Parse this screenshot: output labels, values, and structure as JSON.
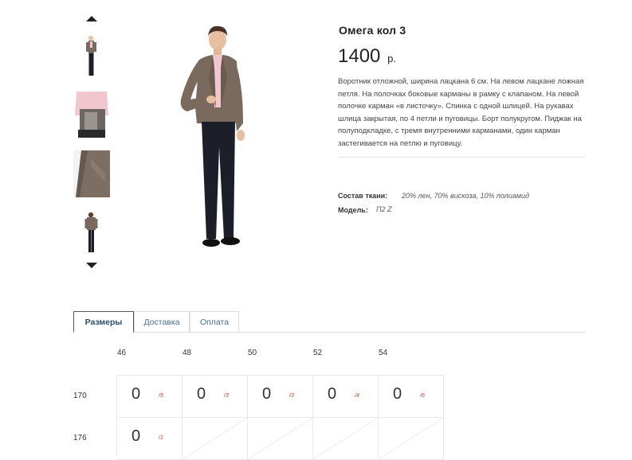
{
  "product": {
    "title": "Омега кол 3",
    "price": "1400",
    "currency": "р.",
    "description": "Воротник отложной, ширина лацкана 6 см. На левом лацкане ложная петля. На полочках боковые карманы в рамку с клапаном. На левой полочке карман «в листочку». Спинка с одной шлицей. На рукавах шлица закрытая, по 4 петли и пуговицы. Борт полукругом. Пиджак на полуподкладке, с тремя внутренними карманами, один карман застегивается на петлю и пуговицу.",
    "specs": {
      "fabric_label": "Состав ткани:",
      "fabric_value": "20% лен, 70% вискоза, 10% полиамид",
      "model_label": "Модель:",
      "model_value": "П2 Z"
    }
  },
  "gallery": {
    "up_icon": "arrow-up-icon",
    "down_icon": "arrow-down-icon",
    "thumbs": [
      "full-figure",
      "open-jacket-lining",
      "lapel-closeup",
      "back-view"
    ]
  },
  "tabs": [
    {
      "label": "Размеры",
      "active": true
    },
    {
      "label": "Доставка",
      "active": false
    },
    {
      "label": "Оплата",
      "active": false
    }
  ],
  "size_grid": {
    "sizes": [
      "46",
      "48",
      "50",
      "52",
      "54"
    ],
    "heights": [
      "170",
      "176"
    ],
    "rows": [
      [
        {
          "qty": "0",
          "sub": "/5"
        },
        {
          "qty": "0",
          "sub": "/3"
        },
        {
          "qty": "0",
          "sub": "/3"
        },
        {
          "qty": "0",
          "sub": "/4"
        },
        {
          "qty": "0",
          "sub": "/6"
        }
      ],
      [
        {
          "qty": "0",
          "sub": "/1"
        },
        null,
        null,
        null,
        null
      ]
    ]
  },
  "colors": {
    "accent": "#4a6f8f",
    "stock_sub": "#c0392b",
    "jacket": "#7a6a5e"
  }
}
